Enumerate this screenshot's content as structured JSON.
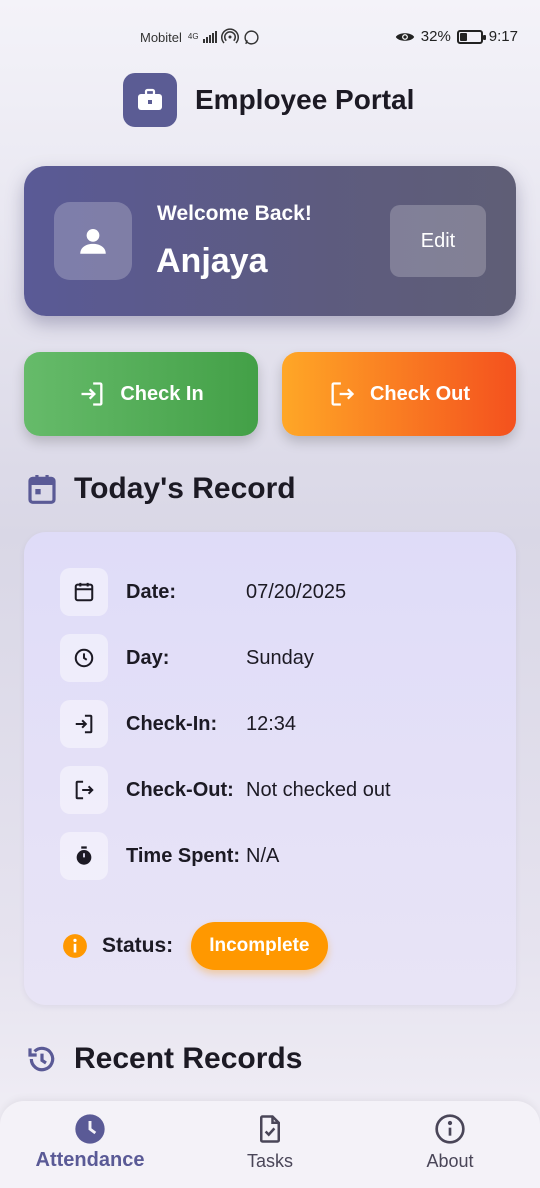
{
  "status_bar": {
    "carrier": "Mobitel",
    "network": "4G",
    "battery": "32%",
    "battery_level": 0.32,
    "time": "9:17"
  },
  "app": {
    "title": "Employee Portal",
    "logo_icon": "briefcase-icon"
  },
  "welcome": {
    "greeting": "Welcome Back!",
    "name": "Anjaya",
    "edit_label": "Edit",
    "avatar_icon": "person-icon"
  },
  "actions": {
    "check_in_label": "Check In",
    "check_out_label": "Check Out"
  },
  "today": {
    "title": "Today's Record",
    "rows": [
      {
        "icon": "calendar-icon",
        "label": "Date:",
        "value": "07/20/2025"
      },
      {
        "icon": "clock-icon",
        "label": "Day:",
        "value": "Sunday"
      },
      {
        "icon": "login-icon",
        "label": "Check-In:",
        "value": "12:34"
      },
      {
        "icon": "logout-icon",
        "label": "Check-Out:",
        "value": "Not checked out"
      },
      {
        "icon": "timer-icon",
        "label": "Time Spent:",
        "value": "N/A"
      }
    ],
    "status_label": "Status:",
    "status_value": "Incomplete",
    "status_color": "#ff9800"
  },
  "recent": {
    "title": "Recent Records"
  },
  "nav": {
    "items": [
      {
        "label": "Attendance",
        "icon": "clock-filled-icon",
        "active": true
      },
      {
        "label": "Tasks",
        "icon": "task-icon",
        "active": false
      },
      {
        "label": "About",
        "icon": "info-icon",
        "active": false
      }
    ]
  },
  "colors": {
    "primary": "#5a5a96",
    "check_in": "#4caf50",
    "check_out": "#f4511e"
  }
}
